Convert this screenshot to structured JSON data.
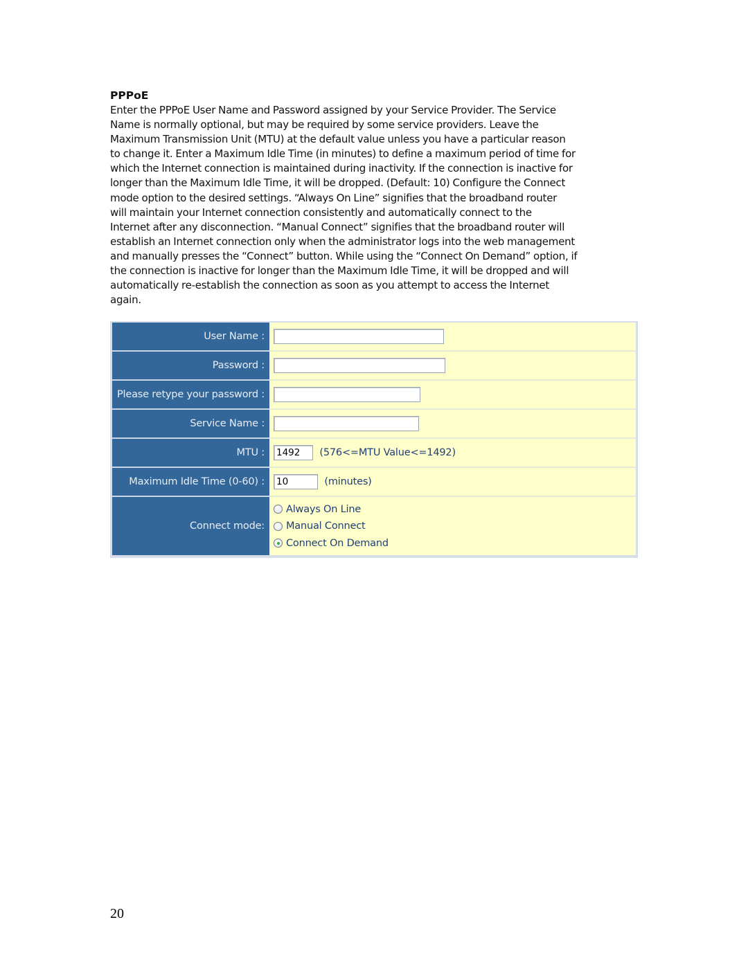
{
  "document": {
    "section_heading": "PPPoE",
    "paragraph_lines": [
      "Enter the PPPoE User Name and Password assigned by your Service Provider. The Service",
      "Name is normally optional, but may be required by some service providers. Leave the",
      "Maximum Transmission Unit (MTU) at the default value unless you have a particular reason",
      "to change it. Enter a Maximum Idle Time (in minutes) to define a maximum period of time for",
      "which the Internet connection is maintained during inactivity. If the connection is inactive for",
      "longer than the Maximum Idle Time, it will be dropped. (Default: 10) Configure the Connect",
      "mode option to the desired settings. “Always On Line” signifies that the broadband router",
      "will maintain your Internet connection consistently and automatically connect to the",
      "Internet after any disconnection. “Manual Connect” signifies that the broadband router will",
      "establish an Internet connection only when the administrator logs into the web management",
      "and manually presses the “Connect” button. While using the “Connect On Demand” option, if",
      "the connection is inactive for longer than the Maximum Idle Time, it will be dropped and will",
      "automatically re-establish the connection as soon as you attempt to access the Internet",
      "again."
    ],
    "page_number": "20"
  },
  "form": {
    "colors": {
      "label_bg": "#336699",
      "label_text": "#e8eef6",
      "value_bg": "#ffffcc",
      "value_text": "#1f3f75",
      "radio_checked_dot": "#3ba838"
    },
    "user_name": {
      "label": "User Name :",
      "value": ""
    },
    "password": {
      "label": "Password :",
      "value": ""
    },
    "retype_password": {
      "label": "Please retype your password :",
      "value": ""
    },
    "service_name": {
      "label": "Service Name :",
      "value": ""
    },
    "mtu": {
      "label": "MTU :",
      "value": "1492",
      "hint": "(576<=MTU Value<=1492)"
    },
    "max_idle_time": {
      "label": "Maximum Idle Time (0-60) :",
      "value": "10",
      "hint": "(minutes)"
    },
    "connect_mode": {
      "label": "Connect mode:",
      "options": [
        {
          "label": "Always On Line",
          "checked": false
        },
        {
          "label": "Manual Connect",
          "checked": false
        },
        {
          "label": "Connect On Demand",
          "checked": true
        }
      ]
    }
  }
}
